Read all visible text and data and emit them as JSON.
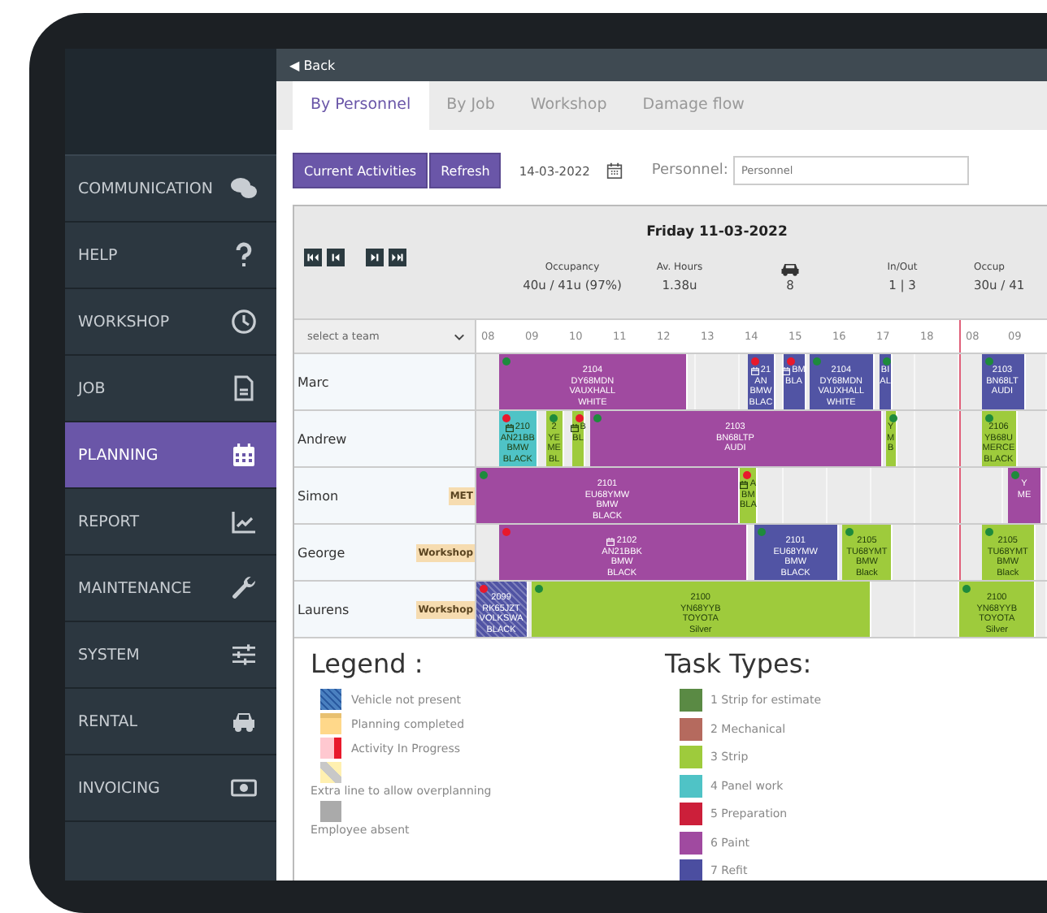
{
  "back": "◀ Back",
  "sidebar": {
    "items": [
      {
        "label": "COMMUNICATION",
        "selected": false
      },
      {
        "label": "HELP",
        "selected": false
      },
      {
        "label": "WORKSHOP",
        "selected": false
      },
      {
        "label": "JOB",
        "selected": false
      },
      {
        "label": "PLANNING",
        "selected": true
      },
      {
        "label": "REPORT",
        "selected": false
      },
      {
        "label": "MAINTENANCE",
        "selected": false
      },
      {
        "label": "SYSTEM",
        "selected": false
      },
      {
        "label": "RENTAL",
        "selected": false
      },
      {
        "label": "INVOICING",
        "selected": false
      }
    ]
  },
  "tabs": [
    {
      "label": "By Personnel",
      "selected": true
    },
    {
      "label": "By Job",
      "selected": false
    },
    {
      "label": "Workshop",
      "selected": false
    },
    {
      "label": "Damage flow",
      "selected": false
    }
  ],
  "toolbar": {
    "buttons": [
      "Current Activities",
      "Refresh"
    ],
    "date": "14-03-2022",
    "personnel_label": "Personnel:",
    "personnel_placeholder": "Personnel"
  },
  "planner": {
    "day_title": "Friday 11-03-2022",
    "stats": [
      {
        "kind": "text",
        "label": "Occupancy",
        "value": "40u / 41u (97%)"
      },
      {
        "kind": "text",
        "label": "Av. Hours",
        "value": "1.38u"
      },
      {
        "kind": "car",
        "value": "8"
      },
      {
        "kind": "text",
        "label": "In/Out",
        "value": "1 | 3"
      },
      {
        "kind": "text",
        "label": "Occup",
        "value": "30u / 41"
      }
    ],
    "team_select": "select a team",
    "days": [
      {
        "hours": [
          "08",
          "09",
          "10",
          "11",
          "12",
          "13",
          "14",
          "15",
          "16",
          "17",
          "18"
        ]
      },
      {
        "hours": [
          "08",
          "09"
        ]
      }
    ],
    "rows": [
      {
        "name": "Marc",
        "blocks": [
          {
            "color": "#a04aa0",
            "status": {
              "color": "#1e8a3c"
            },
            "calendar": false,
            "vehicle_present": true,
            "lines": [
              "2104",
              "DY68MDN",
              "VAUXHALL",
              "WHITE"
            ]
          },
          {
            "color": "#5154a4",
            "status": {
              "color": "#e8192c"
            },
            "calendar": true,
            "vehicle_present": true,
            "lines": [
              "21",
              "AN",
              "BMW",
              "BLAC"
            ]
          },
          {
            "color": "#5154a4",
            "status": {
              "color": "#e8192c"
            },
            "calendar": true,
            "vehicle_present": true,
            "lines": [
              "BM",
              "BLA"
            ]
          },
          {
            "color": "#5154a4",
            "status": {
              "color": "#1e8a3c"
            },
            "calendar": false,
            "vehicle_present": true,
            "lines": [
              "2104",
              "DY68MDN",
              "VAUXHALL",
              "WHITE"
            ]
          },
          {
            "color": "#5154a4",
            "status": {
              "color": "#1e8a3c"
            },
            "calendar": false,
            "vehicle_present": true,
            "lines": [
              "BI",
              "AL"
            ]
          },
          {
            "color": "#5154a4",
            "status": {
              "color": "#1e8a3c"
            },
            "calendar": false,
            "vehicle_present": true,
            "lines": [
              "2103",
              "BN68LT",
              "AUDI"
            ]
          }
        ]
      },
      {
        "name": "Andrew",
        "blocks": [
          {
            "color": "#4fc3c6",
            "status": {
              "color": "#e8192c"
            },
            "calendar": true,
            "vehicle_present": true,
            "lines": [
              "210",
              "AN21BB",
              "BMW",
              "BLACK"
            ]
          },
          {
            "color": "#9ecb3c",
            "status": {
              "color": "#1e8a3c"
            },
            "calendar": false,
            "vehicle_present": true,
            "lines": [
              "2",
              "YE",
              "ME",
              "BL"
            ]
          },
          {
            "color": "#9ecb3c",
            "status": {
              "color": "#e8192c"
            },
            "calendar": true,
            "vehicle_present": true,
            "lines": [
              "B",
              "BL"
            ]
          },
          {
            "color": "#a04aa0",
            "status": {
              "color": "#1e8a3c"
            },
            "calendar": false,
            "vehicle_present": true,
            "lines": [
              "2103",
              "BN68LTP",
              "AUDI"
            ]
          },
          {
            "color": "#9ecb3c",
            "status": {
              "color": "#1e8a3c"
            },
            "calendar": false,
            "vehicle_present": true,
            "lines": [
              "Y",
              "M",
              "B"
            ]
          },
          {
            "color": "#9ecb3c",
            "status": {
              "color": "#1e8a3c"
            },
            "calendar": false,
            "vehicle_present": true,
            "lines": [
              "2106",
              "YB68U",
              "MERCE",
              "BLACK"
            ]
          }
        ]
      },
      {
        "name": "Simon",
        "badge": "MET",
        "blocks": [
          {
            "color": "#a04aa0",
            "status": {
              "color": "#1e8a3c"
            },
            "calendar": false,
            "vehicle_present": true,
            "lines": [
              "2101",
              "EU68YMW",
              "BMW",
              "BLACK"
            ]
          },
          {
            "color": "#9ecb3c",
            "status": {
              "color": "#e8192c"
            },
            "calendar": true,
            "vehicle_present": true,
            "lines": [
              "A",
              "BM",
              "BLA"
            ]
          },
          {
            "color": "#a04aa0",
            "status": {
              "color": "#1e8a3c"
            },
            "calendar": false,
            "vehicle_present": true,
            "lines": [
              "Y",
              "ME"
            ]
          }
        ]
      },
      {
        "name": "George",
        "badge": "Workshop",
        "blocks": [
          {
            "color": "#a04aa0",
            "status": {
              "color": "#e8192c"
            },
            "calendar": true,
            "vehicle_present": true,
            "lines": [
              "2102",
              "AN21BBK",
              "BMW",
              "BLACK"
            ]
          },
          {
            "color": "#5154a4",
            "status": {
              "color": "#1e8a3c"
            },
            "calendar": false,
            "vehicle_present": true,
            "lines": [
              "2101",
              "EU68YMW",
              "BMW",
              "BLACK"
            ]
          },
          {
            "color": "#9ecb3c",
            "status": {
              "color": "#1e8a3c"
            },
            "calendar": false,
            "vehicle_present": true,
            "lines": [
              "2105",
              "TU68YMT",
              "BMW",
              "Black"
            ]
          },
          {
            "color": "#9ecb3c",
            "status": {
              "color": "#1e8a3c"
            },
            "calendar": false,
            "vehicle_present": true,
            "lines": [
              "2105",
              "TU68YMT",
              "BMW",
              "Black"
            ]
          }
        ]
      },
      {
        "name": "Laurens",
        "badge": "Workshop",
        "blocks": [
          {
            "color": "#5154a4",
            "status": {
              "color": "#e8192c"
            },
            "calendar": false,
            "vehicle_present": false,
            "lines": [
              "2099",
              "RK65JZT",
              "VOLKSWA",
              "BLACK"
            ]
          },
          {
            "color": "#9ecb3c",
            "status": {
              "color": "#1e8a3c"
            },
            "calendar": false,
            "vehicle_present": true,
            "lines": [
              "2100",
              "YN68YYB",
              "TOYOTA",
              "Silver"
            ]
          },
          {
            "color": "#9ecb3c",
            "status": {
              "color": "#1e8a3c"
            },
            "calendar": false,
            "vehicle_present": true,
            "lines": [
              "2100",
              "YN68YYB",
              "TOYOTA",
              "Silver"
            ]
          }
        ]
      }
    ]
  },
  "legend": {
    "title": "Legend :",
    "items": [
      {
        "kind": "not_present",
        "label": "Vehicle not present"
      },
      {
        "kind": "completed",
        "label": "Planning completed"
      },
      {
        "kind": "in_progress",
        "label": "Activity In Progress"
      },
      {
        "kind": "overplanning",
        "label": "Extra line to allow overplanning"
      },
      {
        "kind": "absent",
        "label": "Employee absent"
      }
    ]
  },
  "task_types": {
    "title": "Task Types:",
    "items": [
      {
        "label": "1 Strip for estimate",
        "color": "#5a8a44"
      },
      {
        "label": "2 Mechanical",
        "color": "#b56a5e"
      },
      {
        "label": "3 Strip",
        "color": "#9ecb3c"
      },
      {
        "label": "4 Panel work",
        "color": "#4fc3c6"
      },
      {
        "label": "5 Preparation",
        "color": "#cc1f3a"
      },
      {
        "label": "6 Paint",
        "color": "#a04aa0"
      },
      {
        "label": "7 Refit",
        "color": "#4b4ea0"
      }
    ]
  }
}
